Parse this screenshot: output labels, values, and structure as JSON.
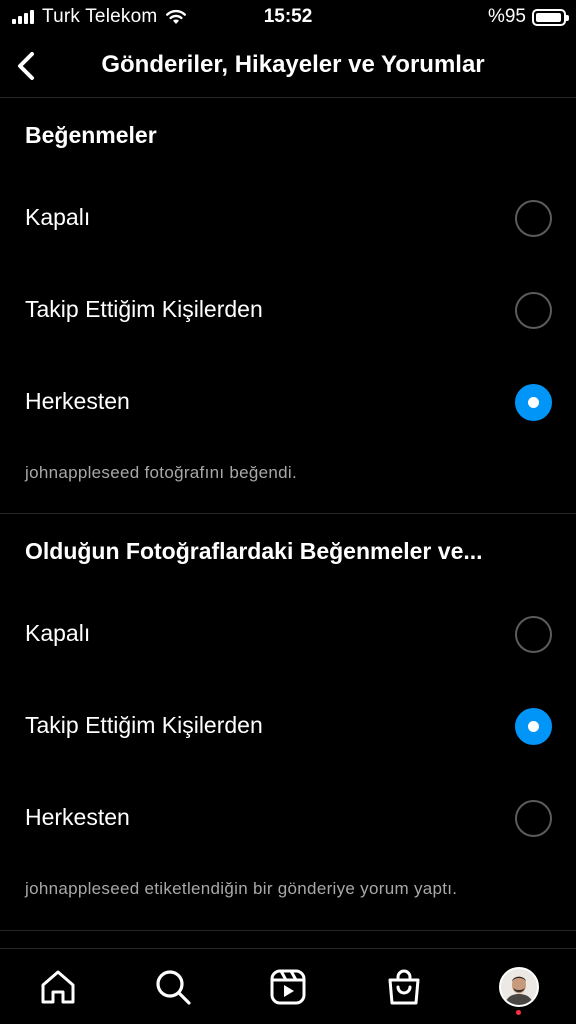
{
  "status_bar": {
    "carrier": "Turk Telekom",
    "time": "15:52",
    "battery": "%95",
    "battery_level": 0.95
  },
  "header": {
    "title": "Gönderiler, Hikayeler ve Yorumlar",
    "back_icon": "chevron-left-icon"
  },
  "sections": [
    {
      "title": "Beğenmeler",
      "options": [
        {
          "label": "Kapalı",
          "selected": false
        },
        {
          "label": "Takip Ettiğim Kişilerden",
          "selected": false
        },
        {
          "label": "Herkesten",
          "selected": true
        }
      ],
      "hint": "johnappleseed fotoğrafını beğendi."
    },
    {
      "title": "Olduğun Fotoğraflardaki Beğenmeler ve...",
      "options": [
        {
          "label": "Kapalı",
          "selected": false
        },
        {
          "label": "Takip Ettiğim Kişilerden",
          "selected": true
        },
        {
          "label": "Herkesten",
          "selected": false
        }
      ],
      "hint": "johnappleseed etiketlendiğin bir gönderiye yorum yaptı."
    }
  ],
  "tab_bar": {
    "items": [
      "home-icon",
      "search-icon",
      "reels-icon",
      "shop-icon",
      "profile-avatar"
    ],
    "notification_color": "#ff3040"
  },
  "colors": {
    "background": "#000000",
    "accent": "#0095f6",
    "secondary_text": "#a8a8a8",
    "divider": "#262626"
  }
}
